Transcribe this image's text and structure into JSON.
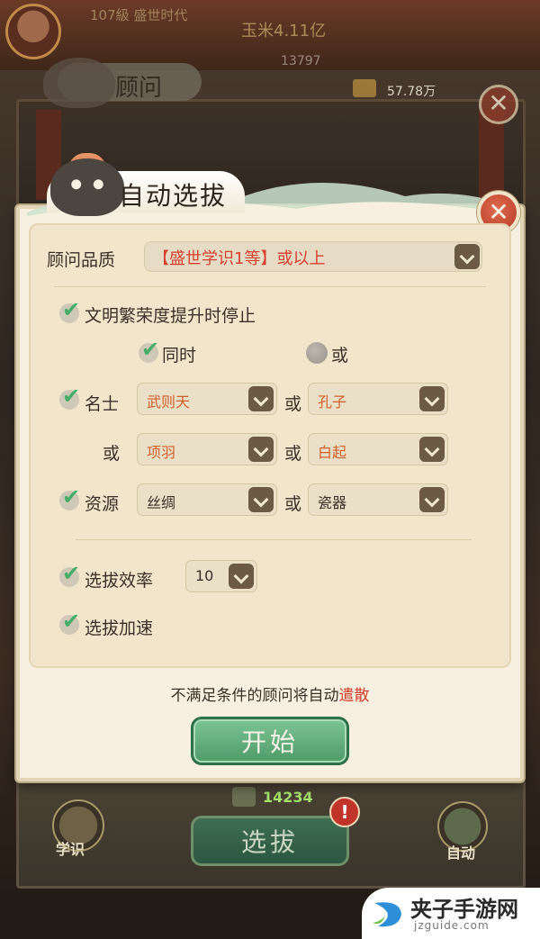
{
  "background": {
    "player_level_text": "107級 盛世时代",
    "power_text": "玉米4.11亿",
    "stat_value": "13797",
    "coin_amount": "57.78万",
    "panel_title": "顾问",
    "close_glyph": "✕",
    "cost_amount": "14234",
    "left_button_label": "学识",
    "select_button_label": "选拔",
    "right_button_label": "自动",
    "alert_badge": "!"
  },
  "dialog": {
    "title": "自动选拔",
    "close_glyph": "✕",
    "quality_label": "顾问品质",
    "quality_value": "【盛世学识1等】或以上",
    "prosperity_stop_label": "文明繁荣度提升时停止",
    "mode_simultaneous": "同时",
    "mode_or": "或",
    "celebrity_label": "名士",
    "celebrity_1": "武则天",
    "celebrity_2": "孔子",
    "celebrity_3": "项羽",
    "celebrity_4": "白起",
    "resource_label": "资源",
    "resource_1": "丝绸",
    "resource_2": "瓷器",
    "or_word": "或",
    "efficiency_label": "选拔效率",
    "efficiency_value": "10",
    "accelerate_label": "选拔加速",
    "footnote_prefix": "不满足条件的顾问将自动",
    "footnote_warning": "遣散",
    "start_label": "开始"
  },
  "checkboxes": {
    "prosperity_stop": true,
    "simultaneous": true,
    "celebrity": true,
    "resource": true,
    "efficiency": true,
    "accelerate": true
  },
  "watermark": {
    "text": "夹子手游网",
    "url": "jzguide.com"
  },
  "colors": {
    "accent_green": "#49ad6a",
    "warning_red": "#d03a2a",
    "orange_value": "#d0602a"
  }
}
